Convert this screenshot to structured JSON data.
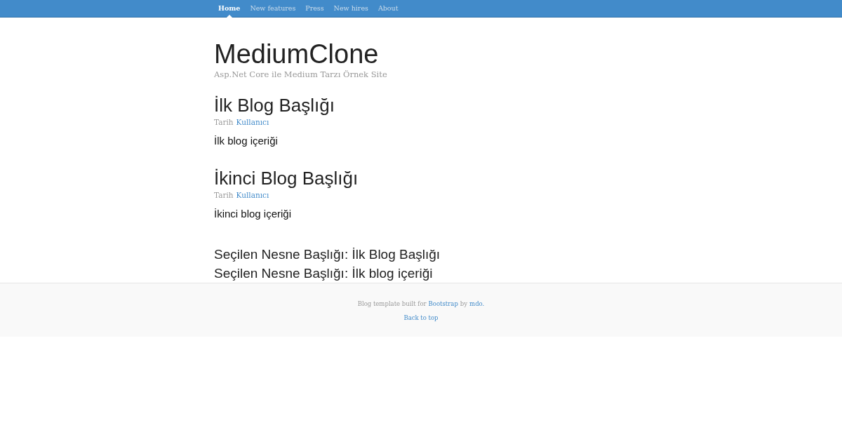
{
  "nav": {
    "items": [
      {
        "label": "Home",
        "selected": true
      },
      {
        "label": "New features",
        "selected": false
      },
      {
        "label": "Press",
        "selected": false
      },
      {
        "label": "New hires",
        "selected": false
      },
      {
        "label": "About",
        "selected": false
      }
    ]
  },
  "header": {
    "title": "MediumClone",
    "subtitle": "Asp.Net Core ile Medium Tarzı Örnek Site"
  },
  "posts": [
    {
      "title": "İlk Blog Başlığı",
      "date": "Tarih",
      "author": "Kullanıcı",
      "body": "İlk blog içeriği"
    },
    {
      "title": "İkinci Blog Başlığı",
      "date": "Tarih",
      "author": "Kullanıcı",
      "body": "İkinci blog içeriği"
    }
  ],
  "selected_lines": [
    "Seçilen Nesne Başlığı: İlk Blog Başlığı",
    "Seçilen Nesne Başlığı: İlk blog içeriği"
  ],
  "footer": {
    "text_before": "Blog template built for",
    "link_1": "Bootstrap",
    "text_middle": "by",
    "link_2": "mdo.",
    "back_to_top": "Back to top"
  }
}
